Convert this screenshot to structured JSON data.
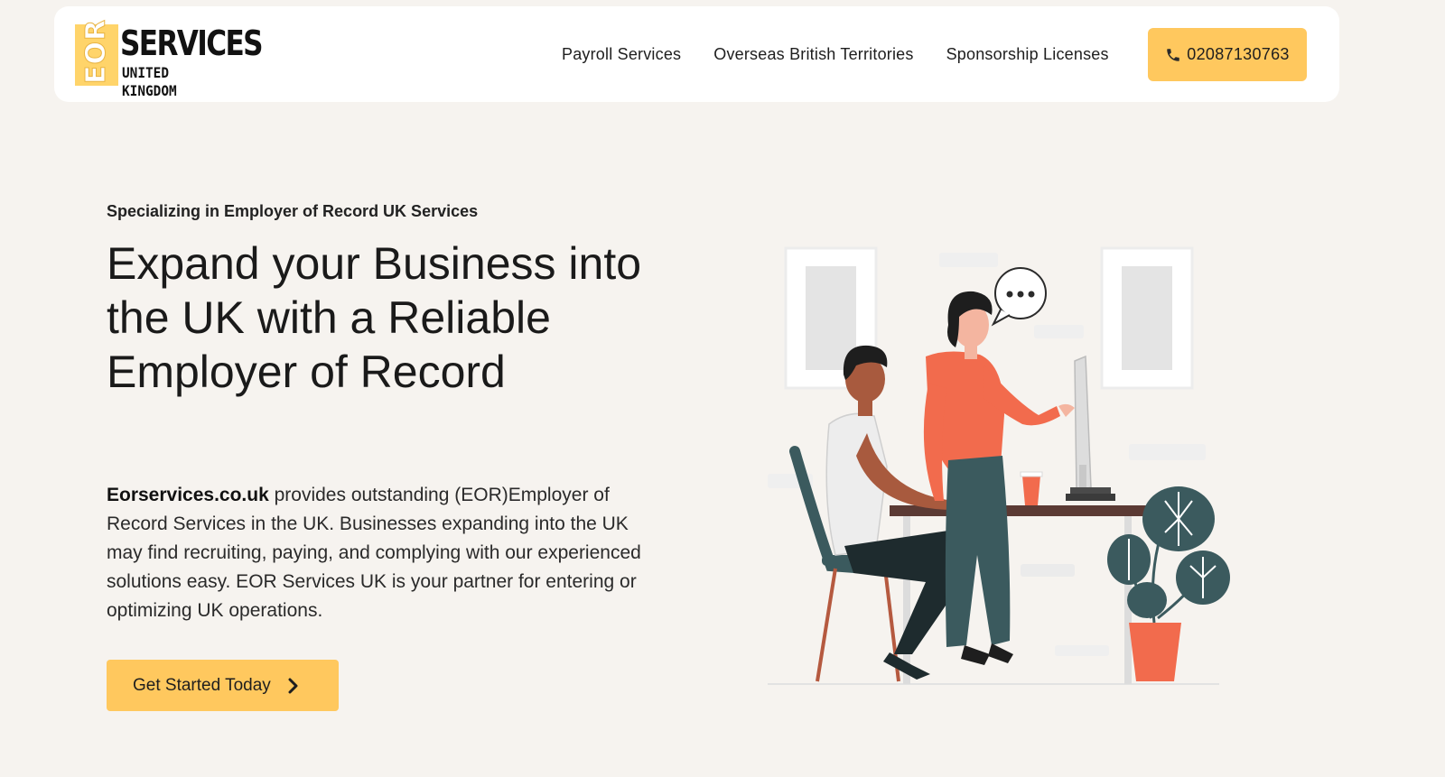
{
  "logo": {
    "mark_text": "EOR",
    "wordmark": "SERVICES",
    "tagline": "UNITED KINGDOM"
  },
  "nav": {
    "items": [
      {
        "label": "Payroll Services"
      },
      {
        "label": "Overseas British Territories"
      },
      {
        "label": "Sponsorship Licenses"
      }
    ],
    "phone_label": "02087130763",
    "phone_icon": "phone-icon"
  },
  "hero": {
    "eyebrow": "Specializing in Employer of Record UK Services",
    "headline": "Expand your Business into the UK with a Reliable Employer of Record",
    "description_strong": "Eorservices.co.uk",
    "description_rest": " provides outstanding (EOR)Employer of Record Services in the UK. Businesses expanding into the UK may find recruiting, paying, and complying with our experienced solutions easy. EOR Services UK is your partner for entering or optimizing UK operations.",
    "cta_label": "Get Started Today",
    "cta_icon": "chevron-right-icon"
  },
  "colors": {
    "background": "#f6f3ef",
    "accent": "#ffc85e",
    "logo_yellow": "#ffd46a",
    "illustration_orange": "#f26b4d",
    "illustration_teal": "#3b5a5e"
  }
}
